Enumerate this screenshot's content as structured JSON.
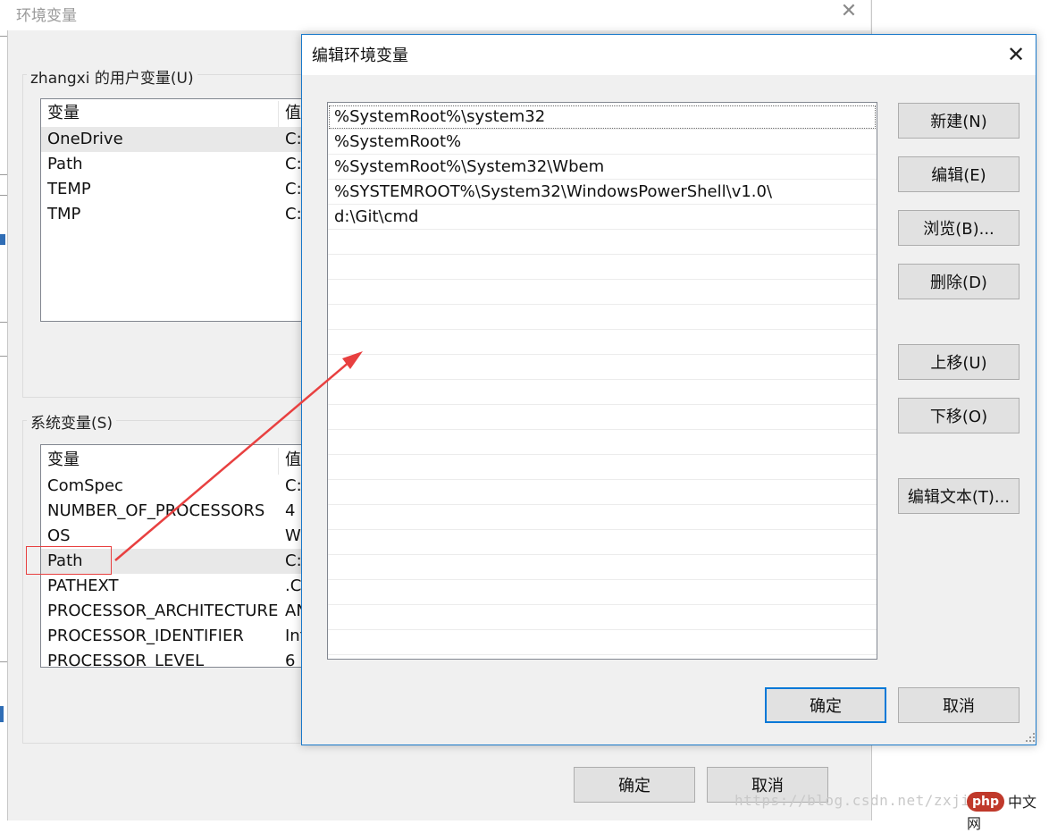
{
  "env_window": {
    "title": "环境变量",
    "user_group_label": "zhangxi 的用户变量(U)",
    "system_group_label": "系统变量(S)",
    "col_var": "变量",
    "col_val": "值",
    "user_vars": [
      {
        "name": "OneDrive",
        "value": "C:\\"
      },
      {
        "name": "Path",
        "value": "C:\\"
      },
      {
        "name": "TEMP",
        "value": "C:\\"
      },
      {
        "name": "TMP",
        "value": "C:\\"
      }
    ],
    "system_vars": [
      {
        "name": "ComSpec",
        "value": "C:\\"
      },
      {
        "name": "NUMBER_OF_PROCESSORS",
        "value": "4"
      },
      {
        "name": "OS",
        "value": "W"
      },
      {
        "name": "Path",
        "value": "C:\\"
      },
      {
        "name": "PATHEXT",
        "value": ".C"
      },
      {
        "name": "PROCESSOR_ARCHITECTURE",
        "value": "AN"
      },
      {
        "name": "PROCESSOR_IDENTIFIER",
        "value": "Int"
      },
      {
        "name": "PROCESSOR_LEVEL",
        "value": "6"
      }
    ],
    "ok_label": "确定",
    "cancel_label": "取消"
  },
  "edit_dialog": {
    "title": "编辑环境变量",
    "paths": [
      "%SystemRoot%\\system32",
      "%SystemRoot%",
      "%SystemRoot%\\System32\\Wbem",
      "%SYSTEMROOT%\\System32\\WindowsPowerShell\\v1.0\\",
      "d:\\Git\\cmd"
    ],
    "buttons": {
      "new": "新建(N)",
      "edit": "编辑(E)",
      "browse": "浏览(B)...",
      "delete": "删除(D)",
      "move_up": "上移(U)",
      "move_down": "下移(O)",
      "edit_text": "编辑文本(T)..."
    },
    "ok_label": "确定",
    "cancel_label": "取消"
  },
  "annotation": {
    "color": "#e84040"
  },
  "watermark": {
    "text": "https://blog.csdn.net/zxji",
    "brand_logo": "php",
    "brand_name": "中文网"
  }
}
